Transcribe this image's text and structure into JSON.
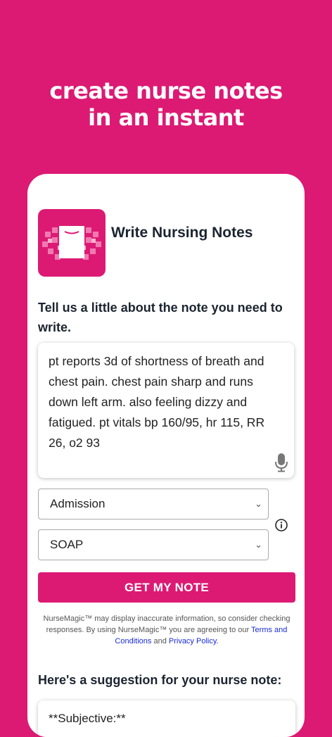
{
  "hero": {
    "line1": "create nurse notes",
    "line2": "in an instant"
  },
  "app": {
    "title": "Write Nursing Notes",
    "icon": "nursemagic-logo-icon"
  },
  "form": {
    "prompt": "Tell us a little about the note you need to write.",
    "input_value": "pt reports 3d of shortness of breath and chest pain. chest pain sharp and runs down left arm. also feeling dizzy and fatigued. pt vitals bp 160/95, hr 115, RR 26, o2 93",
    "note_type": "Admission",
    "note_format": "SOAP",
    "submit_label": "GET MY NOTE"
  },
  "disclaimer": {
    "text": "NurseMagic™ may display inaccurate information, so consider checking responses.  By using NurseMagic™ you are agreeing to our",
    "terms_link": "Terms and Conditions",
    "and": "and",
    "privacy_link": "Privacy Policy."
  },
  "result": {
    "heading": "Here's a suggestion for your nurse note:",
    "first_line": "**Subjective:**"
  },
  "colors": {
    "brand": "#DC1A74",
    "link": "#1a2bd6"
  }
}
